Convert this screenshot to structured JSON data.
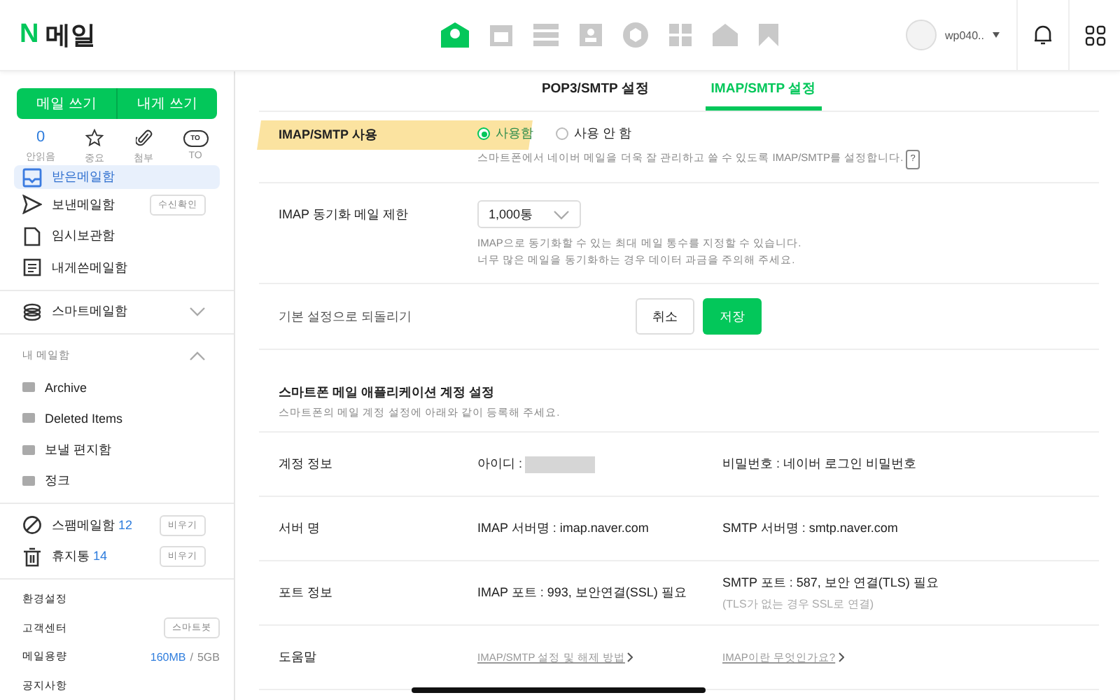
{
  "header": {
    "logo_mark": "N",
    "title": "메일",
    "apps": [
      {
        "kind": "mail",
        "selected": true
      },
      {
        "kind": "calendar",
        "selected": false
      },
      {
        "kind": "list",
        "selected": false
      },
      {
        "kind": "contact",
        "selected": false
      },
      {
        "kind": "cube",
        "selected": false
      },
      {
        "kind": "grid",
        "selected": false
      },
      {
        "kind": "house",
        "selected": false
      },
      {
        "kind": "flag",
        "selected": false
      }
    ],
    "user": "wp040.."
  },
  "sidebar": {
    "compose_buttons": [
      "메일 쓰기",
      "내게 쓰기"
    ],
    "quick": [
      {
        "kind": "count",
        "value": "0",
        "label": "안읽음"
      },
      {
        "kind": "star",
        "label": "중요"
      },
      {
        "kind": "clip",
        "label": "첨부"
      },
      {
        "kind": "to",
        "badge": "TO",
        "label": "TO"
      }
    ],
    "folders": [
      {
        "kind": "inbox",
        "label": "받은메일함",
        "selected": true
      },
      {
        "kind": "sent",
        "label": "보낸메일함",
        "button": "수신확인",
        "selected": false
      },
      {
        "kind": "draft",
        "label": "임시보관함",
        "selected": false
      },
      {
        "kind": "self",
        "label": "내게쓴메일함",
        "selected": false
      }
    ],
    "smart": {
      "label": "스마트메일함",
      "expanded": false
    },
    "my_folders": {
      "label": "내 메일함",
      "expanded": true,
      "children": [
        {
          "label": "Archive"
        },
        {
          "label": "Deleted Items"
        },
        {
          "label": "보낼 편지함"
        },
        {
          "label": "정크"
        }
      ]
    },
    "bins": [
      {
        "kind": "spam",
        "label": "스팸메일함",
        "count": "12",
        "button": "비우기"
      },
      {
        "kind": "trash",
        "label": "휴지통",
        "count": "14",
        "button": "비우기"
      }
    ],
    "footer": [
      {
        "kind": "plain",
        "label": "환경설정"
      },
      {
        "kind": "button",
        "label": "고객센터",
        "button": "스마트봇"
      },
      {
        "kind": "usage",
        "label": "메일용량",
        "used": "160MB",
        "sep": "/",
        "total": "5GB"
      },
      {
        "kind": "plain",
        "label": "공지사항"
      }
    ]
  },
  "tabs": [
    {
      "label": "POP3/SMTP 설정",
      "selected": false
    },
    {
      "label": "IMAP/SMTP 설정",
      "selected": true
    }
  ],
  "settings": {
    "use": {
      "label": "IMAP/SMTP 사용",
      "options": [
        {
          "label": "사용함",
          "selected": true
        },
        {
          "label": "사용 안 함",
          "selected": false
        }
      ],
      "help": "스마트폰에서 네이버 메일을 더욱 잘 관리하고 쓸 수 있도록 IMAP/SMTP를 설정합니다.",
      "help_mark": "?"
    },
    "limit": {
      "label": "IMAP 동기화 메일 제한",
      "value": "1,000통",
      "notes": [
        "IMAP으로 동기화할 수 있는 최대 메일 통수를 지정할 수 있습니다.",
        "너무 많은 메일을 동기화하는 경우 데이터 과금을 주의해 주세요."
      ]
    },
    "reset": {
      "label": "기본 설정으로 되돌리기",
      "cancel": "취소",
      "save": "저장"
    }
  },
  "account": {
    "title": "스마트폰 메일 애플리케이션 계정 설정",
    "subtitle": "스마트폰의 메일 계정 설정에 아래와 같이 등록해 주세요.",
    "rows": [
      {
        "label": "계정 정보",
        "cells": [
          {
            "kind": "redacted",
            "text": "아이디 :"
          },
          {
            "kind": "text",
            "text": "비밀번호 : 네이버 로그인 비밀번호"
          }
        ]
      },
      {
        "label": "서버 명",
        "cells": [
          {
            "kind": "text",
            "text": "IMAP 서버명 : imap.naver.com"
          },
          {
            "kind": "text",
            "text": "SMTP 서버명 : smtp.naver.com"
          }
        ]
      },
      {
        "label": "포트 정보",
        "cells": [
          {
            "kind": "text",
            "text": "IMAP 포트 : 993, 보안연결(SSL) 필요"
          },
          {
            "kind": "text",
            "text": "SMTP 포트 : 587, 보안 연결(TLS) 필요",
            "note": "(TLS가 없는 경우 SSL로 연결)"
          }
        ]
      },
      {
        "label": "도움말",
        "cells": [
          {
            "kind": "link",
            "text": "IMAP/SMTP 설정 및 해제 방법"
          },
          {
            "kind": "link",
            "text": "IMAP이란 무엇인가요?"
          }
        ]
      }
    ]
  }
}
